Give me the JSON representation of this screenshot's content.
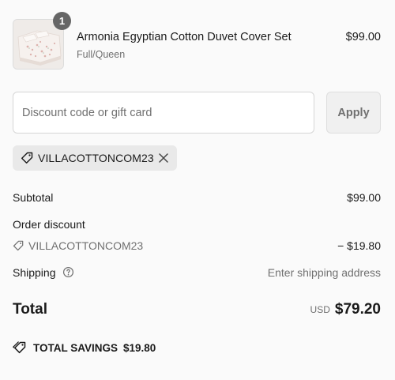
{
  "cart": {
    "items": [
      {
        "quantity": "1",
        "name": "Armonia Egyptian Cotton Duvet Cover Set",
        "variant": "Full/Queen",
        "price": "$99.00"
      }
    ]
  },
  "discount": {
    "placeholder": "Discount code or gift card",
    "value": "",
    "apply_label": "Apply",
    "applied_code": "VILLACOTTONCOM23"
  },
  "summary": {
    "subtotal_label": "Subtotal",
    "subtotal_value": "$99.00",
    "order_discount_label": "Order discount",
    "discount_code": "VILLACOTTONCOM23",
    "discount_amount": "− $19.80",
    "shipping_label": "Shipping",
    "shipping_value": "Enter shipping address",
    "total_label": "Total",
    "total_currency": "USD",
    "total_value": "$79.20",
    "savings_label": "TOTAL SAVINGS",
    "savings_value": "$19.80"
  },
  "icons": {
    "tag": "tag-icon",
    "remove": "close-icon",
    "info": "info-icon",
    "savings": "savings-tag-icon"
  },
  "colors": {
    "text": "#1a1a1a",
    "muted": "#707070",
    "badge": "#666666",
    "chip_bg": "#e9e9e9",
    "button_bg": "#f0f0f0"
  }
}
